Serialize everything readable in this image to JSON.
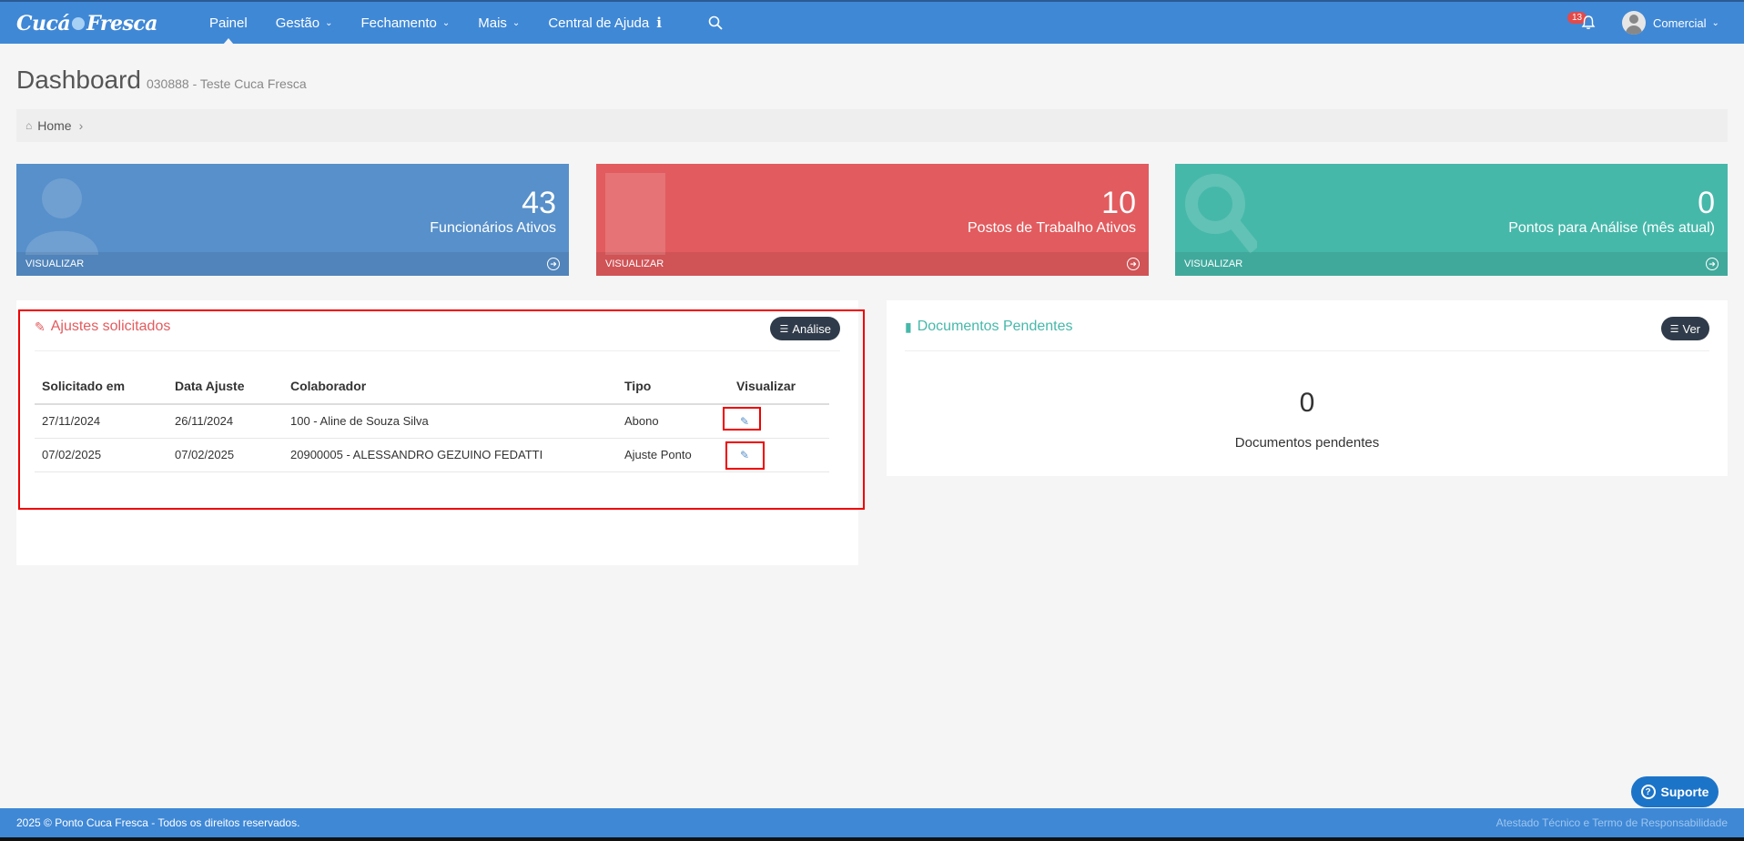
{
  "app": {
    "logo_text": "Cuca Fresca"
  },
  "nav": {
    "items": [
      {
        "label": "Painel"
      },
      {
        "label": "Gestão"
      },
      {
        "label": "Fechamento"
      },
      {
        "label": "Mais"
      },
      {
        "label": "Central de Ajuda"
      }
    ],
    "notifications_count": "13",
    "user_name": "Comercial"
  },
  "page": {
    "title": "Dashboard",
    "subtitle": "030888 - Teste Cuca Fresca",
    "breadcrumb": [
      "Home"
    ]
  },
  "stats": [
    {
      "value": "43",
      "label": "Funcionários Ativos",
      "footer": "VISUALIZAR",
      "color": "#5790ca"
    },
    {
      "value": "10",
      "label": "Postos de Trabalho Ativos",
      "footer": "VISUALIZAR",
      "color": "#e25b5e"
    },
    {
      "value": "0",
      "label": "Pontos para Análise (mês atual)",
      "footer": "VISUALIZAR",
      "color": "#46b8aa"
    }
  ],
  "ajustes": {
    "title": "Ajustes solicitados",
    "button": "Análise",
    "columns": [
      "Solicitado em",
      "Data Ajuste",
      "Colaborador",
      "Tipo",
      "Visualizar"
    ],
    "rows": [
      {
        "solicitado": "27/11/2024",
        "data": "26/11/2024",
        "colaborador": "100 - Aline de Souza Silva",
        "tipo": "Abono"
      },
      {
        "solicitado": "07/02/2025",
        "data": "07/02/2025",
        "colaborador": "20900005 - ALESSANDRO GEZUINO FEDATTI",
        "tipo": "Ajuste Ponto"
      }
    ]
  },
  "documentos": {
    "title": "Documentos Pendentes",
    "button": "Ver",
    "count": "0",
    "label": "Documentos pendentes"
  },
  "footer": {
    "left": "2025 © Ponto Cuca Fresca - Todos os direitos reservados.",
    "right": "Atestado Técnico e Termo de Responsabilidade"
  },
  "support": {
    "label": "Suporte"
  }
}
